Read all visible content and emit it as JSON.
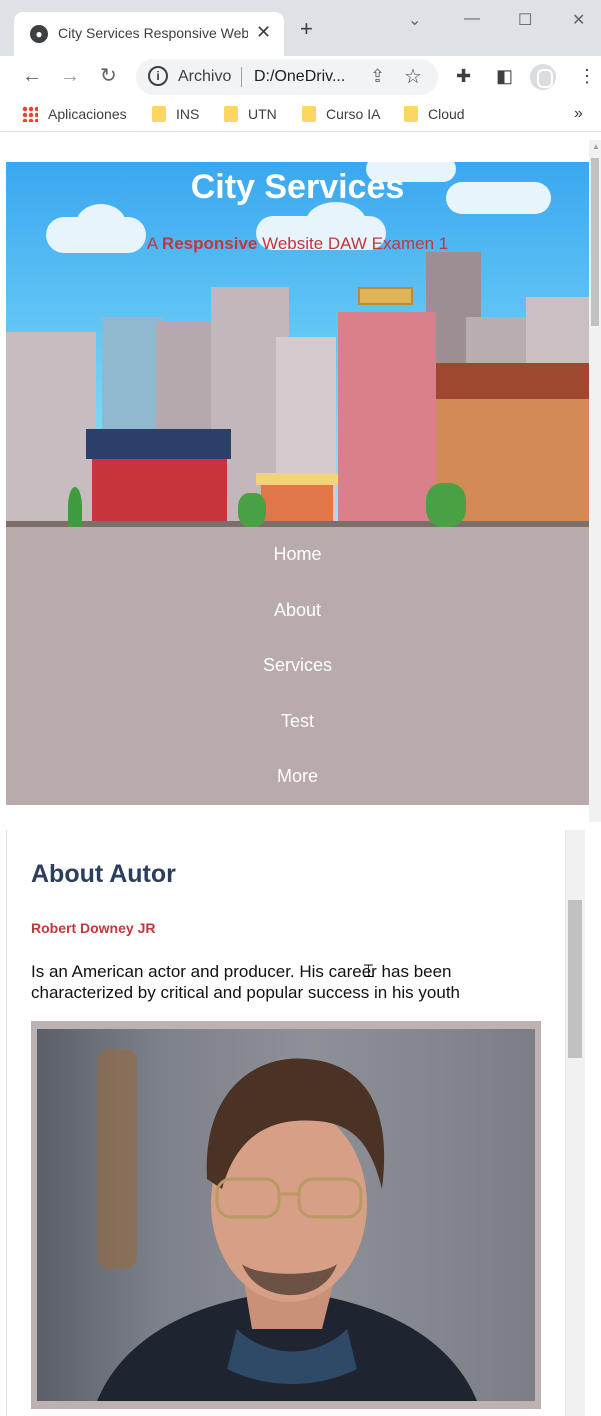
{
  "browser": {
    "tab_title": "City Services Responsive Web",
    "omnibox_label": "Archivo",
    "url": "D:/OneDriv...",
    "bookmarks": [
      "Aplicaciones",
      "INS",
      "UTN",
      "Curso IA",
      "Cloud"
    ]
  },
  "hero": {
    "title": "City Services",
    "subtitle_prefix": "A ",
    "subtitle_strong": "Responsive",
    "subtitle_rest": " Website DAW Examen 1"
  },
  "nav": {
    "items": [
      "Home",
      "About",
      "Services",
      "Test",
      "More"
    ]
  },
  "about": {
    "title": "About Autor",
    "author": "Robert Downey JR",
    "bio": "Is an American actor and producer. His career has been characterized by critical and popular success in his youth"
  },
  "colors": {
    "accent_red": "#c0373f",
    "heading_navy": "#2c3e5c",
    "nav_bg": "#b9abab"
  }
}
